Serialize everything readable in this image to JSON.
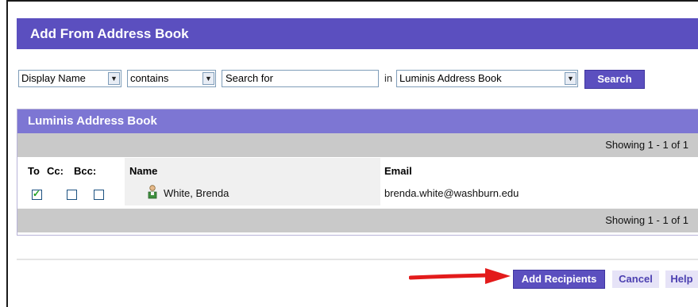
{
  "dialog": {
    "title": "Add From Address Book"
  },
  "search": {
    "field_select": "Display Name",
    "operator_select": "contains",
    "query_value": "Search for",
    "in_label": "in",
    "book_select": "Luminis Address Book",
    "search_button": "Search"
  },
  "results": {
    "panel_title": "Luminis Address Book",
    "showing_top": "Showing 1 - 1  of 1",
    "showing_bottom": "Showing 1 - 1  of 1",
    "columns": {
      "to": "To",
      "cc": "Cc:",
      "bcc": "Bcc:",
      "name": "Name",
      "email": "Email"
    },
    "rows": [
      {
        "to_checked": true,
        "cc_checked": false,
        "bcc_checked": false,
        "name": "White, Brenda",
        "email": "brenda.white@washburn.edu"
      }
    ]
  },
  "footer": {
    "add_button": "Add Recipients",
    "cancel_button": "Cancel",
    "help_button": "Help"
  },
  "colors": {
    "title_bar": "#5b4fbf",
    "panel_header": "#7d76d3",
    "annotation_arrow": "#e31b1b"
  }
}
